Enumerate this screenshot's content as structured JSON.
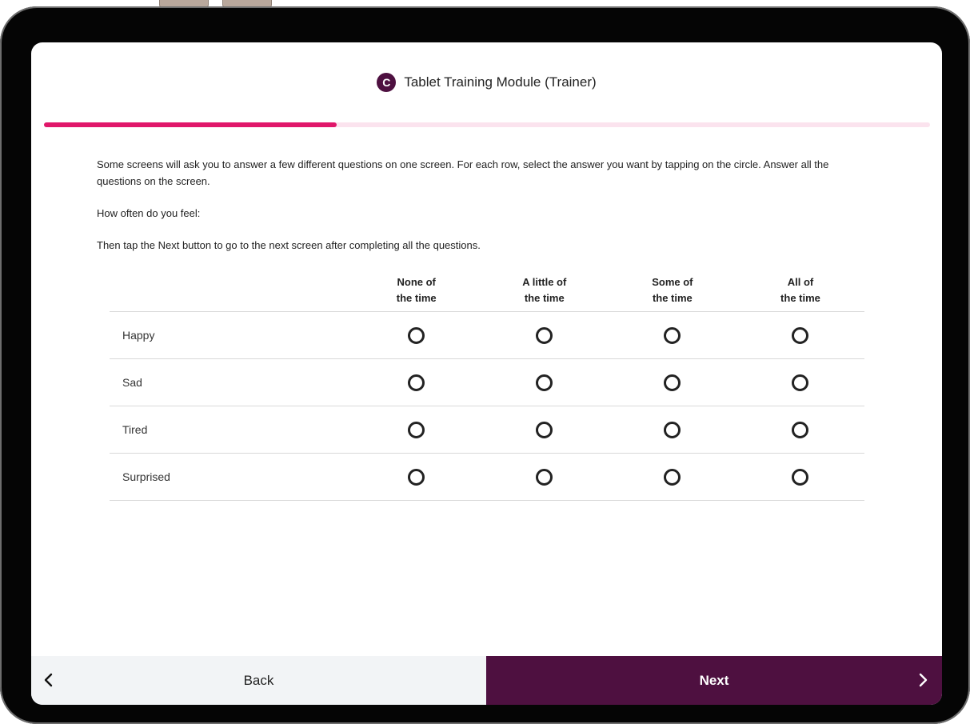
{
  "header": {
    "logo_letter": "C",
    "title": "Tablet Training Module (Trainer)"
  },
  "progress": {
    "fraction": 0.33
  },
  "instructions": {
    "p1": "Some screens will ask you to answer a few different questions on one screen. For each row, select the answer you want by tapping on the circle. Answer all the questions on the screen.",
    "p2": "How often do you feel:",
    "p3": "Then tap the Next button to go to the next screen after completing all the questions."
  },
  "grid": {
    "columns": [
      "None of\nthe time",
      "A little of\nthe time",
      "Some of\nthe time",
      "All of\nthe time"
    ],
    "rows": [
      "Happy",
      "Sad",
      "Tired",
      "Surprised"
    ]
  },
  "footer": {
    "back_label": "Back",
    "next_label": "Next"
  },
  "colors": {
    "brand": "#4e1040",
    "progress": "#e0176a",
    "progress_track": "#fbe3ee"
  }
}
